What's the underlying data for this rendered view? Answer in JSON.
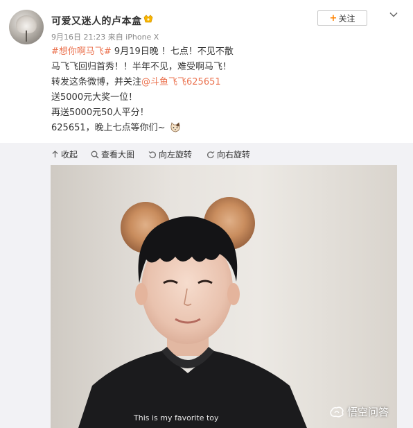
{
  "post": {
    "author": "可爱又迷人的卢本盒",
    "meta": "9月16日 21:23 来自 iPhone X",
    "follow_label": "关注",
    "follow_plus": "+",
    "lines": {
      "l1_hashtag": "#想你啊马飞#",
      "l1_text": " 9月19日晚 ！七点！不见不散",
      "l2": "马飞飞回归首秀！！半年不见，难受啊马飞！",
      "l3_text": "转发这条微博，并关注",
      "l3_mention": "@斗鱼飞飞625651",
      "l4": "送5000元大奖一位！",
      "l5": "再送5000元50人平分！",
      "l6": "625651，晚上七点等你们~"
    }
  },
  "toolbar": {
    "collapse": "收起",
    "view_large": "查看大图",
    "rotate_left": "向左旋转",
    "rotate_right": "向右旋转"
  },
  "photo": {
    "shirt_text": "This is my favorite toy"
  },
  "watermark": {
    "label": "悟空问答"
  },
  "colors": {
    "link": "#eb7350",
    "follow_plus": "#ff8200",
    "toolbar_bg": "#f2f2f5",
    "meta": "#888888"
  }
}
